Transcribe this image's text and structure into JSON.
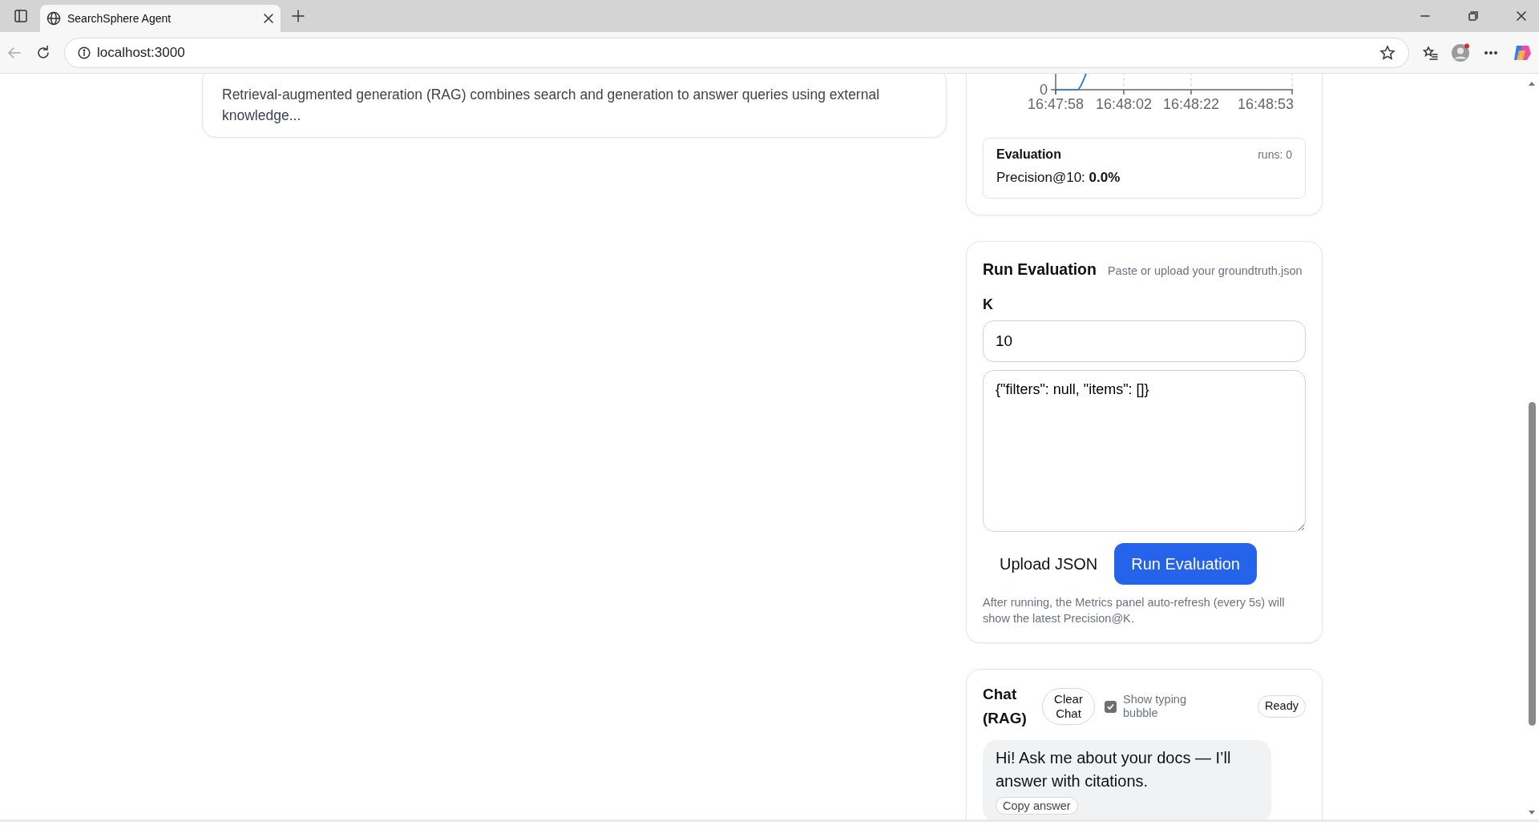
{
  "browser": {
    "tab_title": "SearchSphere Agent",
    "url": "localhost:3000"
  },
  "result_card": {
    "snippet": "Retrieval-augmented generation (RAG) combines search and generation to answer queries using external knowledge..."
  },
  "metrics": {
    "chart": {
      "y_tick_labels": [
        "0"
      ],
      "x_tick_labels": [
        "16:47:58",
        "16:48:02",
        "16:48:22",
        "16:48:53"
      ]
    },
    "evaluation": {
      "title": "Evaluation",
      "runs": "runs: 0",
      "metric_label": "Precision@10:",
      "metric_value": "0.0%"
    }
  },
  "run_evaluation": {
    "title": "Run Evaluation",
    "subtitle": "Paste or upload your groundtruth.json",
    "k_label": "K",
    "k_value": "10",
    "json_value": "{\"filters\": null, \"items\": []}",
    "buttons": [
      {
        "label": "Upload JSON",
        "kind": "plain"
      },
      {
        "label": "Run Evaluation",
        "kind": "primary"
      }
    ],
    "help": "After running, the Metrics panel auto-refresh (every 5s) will show the latest Precision@K."
  },
  "chat": {
    "title": "Chat (RAG)",
    "clear_button": "Clear Chat",
    "typing_bubble": {
      "label": "Show typing bubble",
      "checked": true
    },
    "status": "Ready",
    "messages": [
      {
        "text": "Hi! Ask me about your docs — I’ll answer with citations.",
        "action": "Copy answer"
      }
    ]
  }
}
